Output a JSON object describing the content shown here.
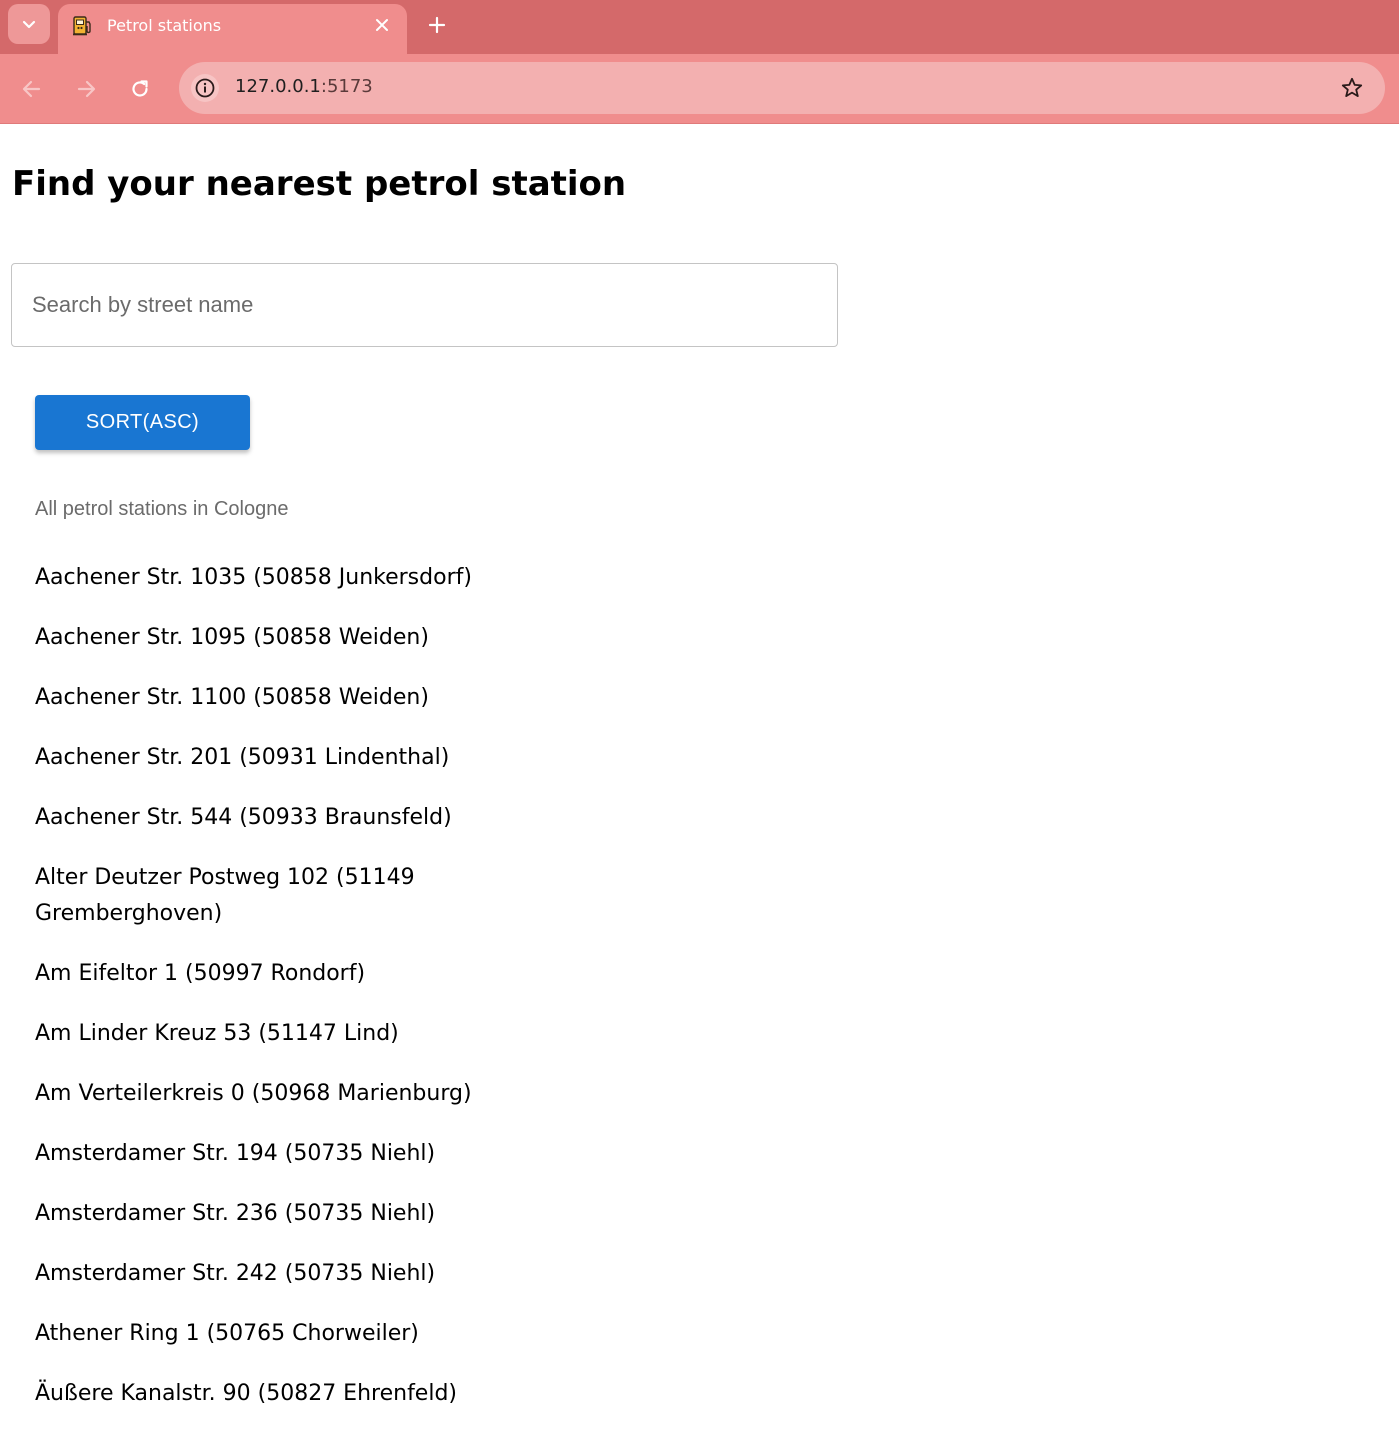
{
  "browser": {
    "tab_title": "Petrol stations",
    "url_host": "127.0.0.1",
    "url_port": ":5173",
    "icons": [
      "chevron-down-icon",
      "fuel-pump-icon",
      "close-icon",
      "plus-icon",
      "back-arrow-icon",
      "forward-arrow-icon",
      "reload-icon",
      "info-icon",
      "star-icon"
    ]
  },
  "page": {
    "title": "Find your nearest petrol station",
    "search_placeholder": "Search by street name",
    "sort_label": "SORT(ASC)",
    "list_caption": "All petrol stations in Cologne",
    "stations": [
      "Aachener Str. 1035 (50858 Junkersdorf)",
      "Aachener Str. 1095 (50858 Weiden)",
      "Aachener Str. 1100 (50858 Weiden)",
      "Aachener Str. 201 (50931 Lindenthal)",
      "Aachener Str. 544 (50933 Braunsfeld)",
      "Alter Deutzer Postweg 102 (51149 Gremberghoven)",
      "Am Eifeltor 1 (50997 Rondorf)",
      "Am Linder Kreuz 53 (51147 Lind)",
      "Am Verteilerkreis 0 (50968 Marienburg)",
      "Amsterdamer Str. 194 (50735 Niehl)",
      "Amsterdamer Str. 236 (50735 Niehl)",
      "Amsterdamer Str. 242 (50735 Niehl)",
      "Athener Ring 1 (50765 Chorweiler)",
      "Äußere Kanalstr. 90 (50827 Ehrenfeld)"
    ]
  },
  "colors": {
    "tabbar": "#d4696a",
    "toolbar": "#f08d8d",
    "omnibox": "#f3b0b0",
    "button": "#1976d2"
  }
}
